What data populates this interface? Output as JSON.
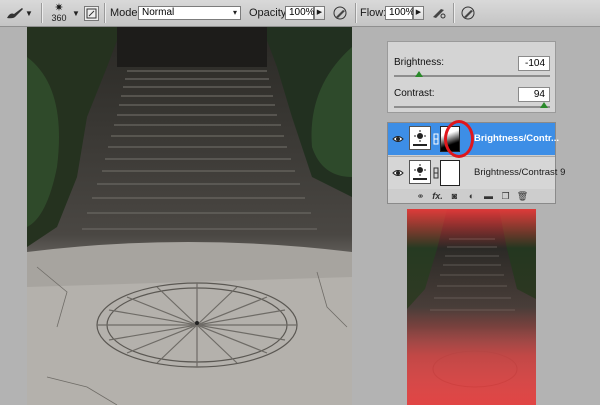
{
  "options_bar": {
    "brush_size": "360",
    "mode_label": "Mode:",
    "mode_value": "Normal",
    "opacity_label": "Opacity:",
    "opacity_value": "100%",
    "flow_label": "Flow:",
    "flow_value": "100%"
  },
  "adjustments": {
    "brightness_label": "Brightness:",
    "brightness_value": "-104",
    "contrast_label": "Contrast:",
    "contrast_value": "94",
    "brightness_fraction": 0.16,
    "contrast_fraction": 0.96
  },
  "layers": {
    "items": [
      {
        "name": "Brightness/Contr...",
        "selected": true
      },
      {
        "name": "Brightness/Contrast 9",
        "selected": false
      }
    ],
    "footer_icons": [
      "link-icon",
      "fx-icon",
      "add-mask-icon",
      "adjustment-icon",
      "folder-icon",
      "new-layer-icon",
      "trash-icon"
    ],
    "fx_label": "fx."
  },
  "colors": {
    "selection_blue": "#3d8ee6",
    "annotation_red": "#e0161b",
    "mask_overlay_red": "#e83b3b"
  }
}
